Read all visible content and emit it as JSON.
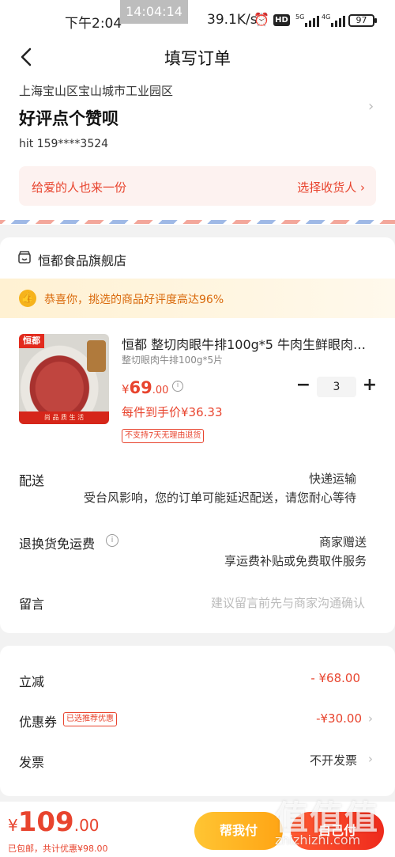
{
  "status_bar": {
    "time": "下午2:04",
    "clock_overlay": "14:04:14",
    "network_speed": "39.1K/s",
    "hd_badge": "HD",
    "sig1": "5G",
    "sig2": "4G",
    "battery": "97",
    "icons": [
      "alarm-icon",
      "hd-icon",
      "signal-icon",
      "battery-icon"
    ]
  },
  "nav": {
    "title": "填写订单",
    "back_icon": "chevron-left-icon"
  },
  "address": {
    "region": "上海宝山区宝山城市工业园区",
    "detail": "好评点个赞呗",
    "contact": "hit  159****3524",
    "chevron": "›"
  },
  "gift": {
    "text": "给爱的人也来一份",
    "action": "选择收货人 ›"
  },
  "shop": {
    "name": "恒都食品旗舰店",
    "icon": "store-icon",
    "praise_icon": "thumbs-up-icon",
    "praise_text": "恭喜你，挑选的商品好评度高达96%"
  },
  "product": {
    "title": "恒都 整切肉眼牛排100g*5 牛肉生鲜眼肉…",
    "spec": "整切眼肉牛排100g*5片",
    "price_currency": "¥",
    "price_int": "69",
    "price_dec": ".00",
    "unit_price": "每件到手价¥36.33",
    "return_tag": "不支持7天无理由退货",
    "image_logo": "恒都",
    "image_footer": "尚  品  质  生  活",
    "quantity": "3",
    "minus": "−",
    "plus": "+"
  },
  "shipping": {
    "label": "配送",
    "value": "快递运输",
    "note": "受台风影响，您的订单可能延迟配送，请您耐心等待"
  },
  "returns": {
    "label": "退换货免运费",
    "value": "商家赠送",
    "note": "享运费补贴或免费取件服务"
  },
  "message": {
    "label": "留言",
    "placeholder": "建议留言前先与商家沟通确认"
  },
  "fees": {
    "discount_label": "立减",
    "discount_value": "- ¥68.00",
    "coupon_label": "优惠券",
    "coupon_tag": "已选推荐优惠",
    "coupon_value": "-¥30.00",
    "invoice_label": "发票",
    "invoice_value": "不开发票",
    "chevron": "›"
  },
  "bottom": {
    "currency": "¥",
    "total_int": "109",
    "total_dec": ".00",
    "subtotal": "已包邮，共计优惠¥98.00",
    "help_button": "帮我付",
    "pay_button": "自己付"
  },
  "watermark": {
    "main": "值值值",
    "sub": "zhizhizhi.com"
  },
  "colors": {
    "accent": "#e8442e",
    "gold": "#ffb21e"
  }
}
